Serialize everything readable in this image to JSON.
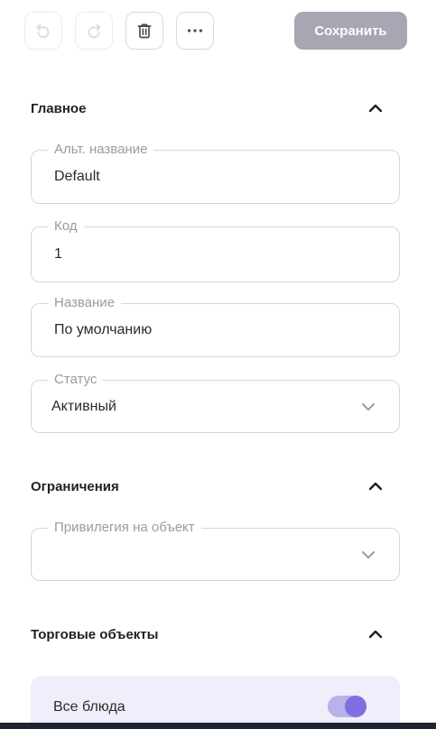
{
  "toolbar": {
    "undo_icon": "undo-icon",
    "redo_icon": "redo-icon",
    "delete_icon": "trash-icon",
    "more_icon": "more-horizontal-icon",
    "save_label": "Сохранить"
  },
  "sections": {
    "main": {
      "title": "Главное",
      "fields": {
        "alt_name": {
          "label": "Альт. название",
          "value": "Default"
        },
        "code": {
          "label": "Код",
          "value": "1"
        },
        "name": {
          "label": "Название",
          "value": "По умолчанию"
        },
        "status": {
          "label": "Статус",
          "value": "Активный"
        }
      }
    },
    "restrictions": {
      "title": "Ограничения",
      "fields": {
        "privilege": {
          "label": "Привилегия на объект",
          "value": ""
        }
      }
    },
    "trade_objects": {
      "title": "Торговые объекты",
      "all_dishes": {
        "label": "Все блюда",
        "enabled": true
      }
    }
  },
  "colors": {
    "save_button_bg": "#a7a6b3",
    "toggle_track": "#b8b2ea",
    "toggle_knob": "#7f6fe0",
    "card_bg": "#efeefa"
  }
}
